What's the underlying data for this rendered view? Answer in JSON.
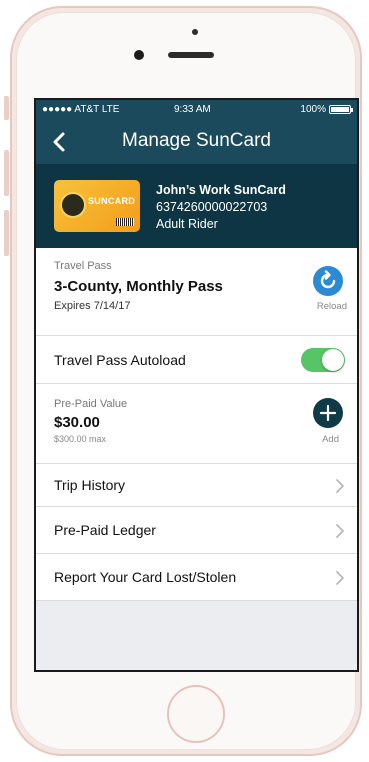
{
  "status_bar": {
    "carrier": "●●●●● AT&T  LTE",
    "time": "9:33 AM",
    "battery": "100%"
  },
  "nav": {
    "title": "Manage SunCard",
    "back_icon": "chevron-left-icon"
  },
  "card": {
    "name": "John’s Work SunCard",
    "number": "6374260000022703",
    "rider_type": "Adult Rider",
    "image_brand": "SUNCARD"
  },
  "travel_pass": {
    "label": "Travel Pass",
    "name": "3-County, Monthly Pass",
    "expires": "Expires 7/14/17",
    "action_label": "Reload"
  },
  "autoload": {
    "label": "Travel Pass Autoload",
    "enabled": true
  },
  "prepaid": {
    "label": "Pre-Paid Value",
    "value": "$30.00",
    "max": "$300.00 max",
    "action_label": "Add"
  },
  "menu": [
    {
      "label": "Trip History"
    },
    {
      "label": "Pre-Paid Ledger"
    },
    {
      "label": "Report Your Card Lost/Stolen"
    }
  ],
  "colors": {
    "nav_bg": "#1a4a5b",
    "card_bg": "#0e3544",
    "reload_blue": "#2a8ad4",
    "toggle_green": "#57c466",
    "add_dark": "#0f3a48"
  }
}
